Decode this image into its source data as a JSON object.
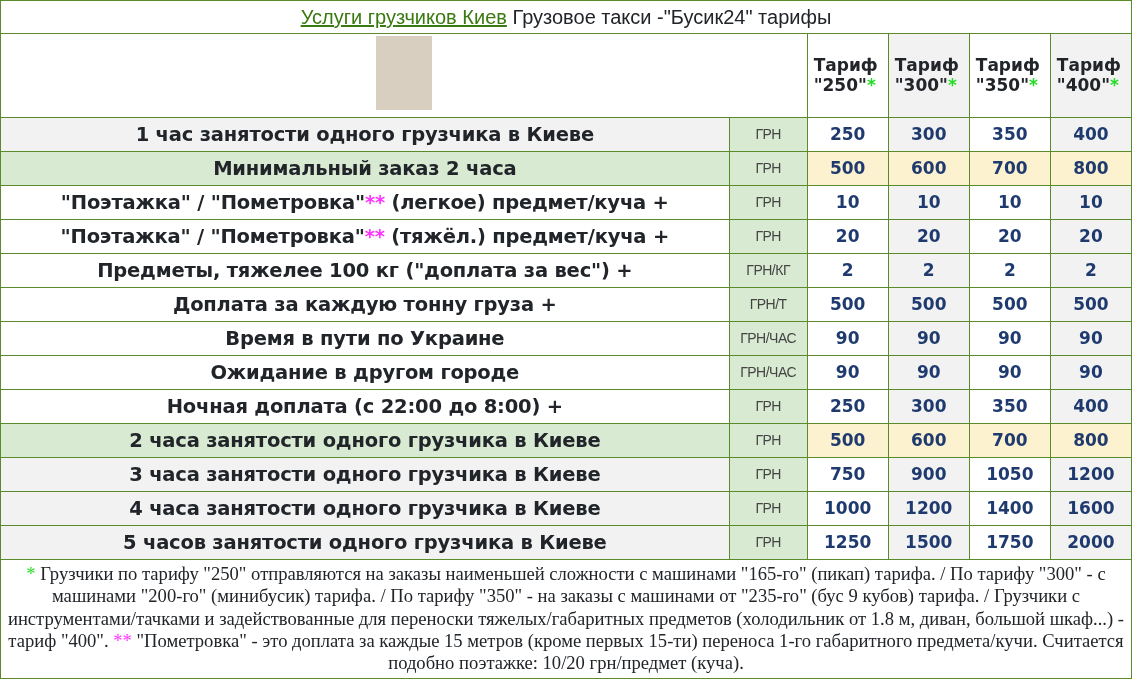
{
  "title": {
    "link": "Услуги грузчиков Киев",
    "text": "Грузовое такси -\"Бусик24\" тарифы"
  },
  "tariffs": [
    {
      "label": "Тариф \"250\"",
      "mark": "*",
      "shaded": false
    },
    {
      "label": "Тариф \"300\"",
      "mark": "*",
      "shaded": true
    },
    {
      "label": "Тариф \"350\"",
      "mark": "*",
      "shaded": false
    },
    {
      "label": "Тариф \"400\"",
      "mark": "*",
      "shaded": true
    }
  ],
  "rows": [
    {
      "kind": "grey",
      "label": [
        {
          "text": "1 час занятости одного грузчика в Киеве"
        }
      ],
      "unit": "ГРН",
      "values": [
        "250",
        "300",
        "350",
        "400"
      ]
    },
    {
      "kind": "highlight",
      "label": [
        {
          "text": "Минимальный заказ 2 часа"
        }
      ],
      "unit": "ГРН",
      "values": [
        "500",
        "600",
        "700",
        "800"
      ]
    },
    {
      "kind": "plain",
      "label": [
        {
          "text": "\"Поэтажка\" / \"Пометровка\""
        },
        {
          "text": "**",
          "color": "#ff33ff"
        },
        {
          "text": " (легкое) предмет/куча +"
        }
      ],
      "unit": "ГРН",
      "values": [
        "10",
        "10",
        "10",
        "10"
      ]
    },
    {
      "kind": "plain",
      "label": [
        {
          "text": "\"Поэтажка\" / \"Пометровка\""
        },
        {
          "text": "**",
          "color": "#ff33ff"
        },
        {
          "text": " (тяжёл.) предмет/куча +"
        }
      ],
      "unit": "ГРН",
      "values": [
        "20",
        "20",
        "20",
        "20"
      ]
    },
    {
      "kind": "plain",
      "label": [
        {
          "text": "Предметы, тяжелее 100 кг (\"доплата за вес\") +"
        }
      ],
      "unit": "ГРН/КГ",
      "values": [
        "2",
        "2",
        "2",
        "2"
      ]
    },
    {
      "kind": "plain",
      "label": [
        {
          "text": "Доплата за каждую тонну груза +"
        }
      ],
      "unit": "ГРН/Т",
      "values": [
        "500",
        "500",
        "500",
        "500"
      ]
    },
    {
      "kind": "plain",
      "label": [
        {
          "text": "Время в пути по Украине"
        }
      ],
      "unit": "ГРН/ЧАС",
      "values": [
        "90",
        "90",
        "90",
        "90"
      ]
    },
    {
      "kind": "plain",
      "label": [
        {
          "text": "Ожидание в другом городе"
        }
      ],
      "unit": "ГРН/ЧАС",
      "values": [
        "90",
        "90",
        "90",
        "90"
      ]
    },
    {
      "kind": "plain",
      "label": [
        {
          "text": "Ночная доплата (с 22:00 до 8:00) +"
        }
      ],
      "unit": "ГРН",
      "values": [
        "250",
        "300",
        "350",
        "400"
      ]
    },
    {
      "kind": "highlight",
      "label": [
        {
          "text": "2 часа занятости одного грузчика в Киеве"
        }
      ],
      "unit": "ГРН",
      "values": [
        "500",
        "600",
        "700",
        "800"
      ]
    },
    {
      "kind": "grey",
      "label": [
        {
          "text": "3 часа занятости одного грузчика в Киеве"
        }
      ],
      "unit": "ГРН",
      "values": [
        "750",
        "900",
        "1050",
        "1200"
      ]
    },
    {
      "kind": "grey",
      "label": [
        {
          "text": "4 часа занятости одного грузчика в Киеве"
        }
      ],
      "unit": "ГРН",
      "values": [
        "1000",
        "1200",
        "1400",
        "1600"
      ]
    },
    {
      "kind": "grey",
      "label": [
        {
          "text": "5 часов занятости одного грузчика в Киеве"
        }
      ],
      "unit": "ГРН",
      "values": [
        "1250",
        "1500",
        "1750",
        "2000"
      ]
    }
  ],
  "footnote": [
    {
      "text": "*",
      "color": "#22dd22"
    },
    {
      "text": " Грузчики по тарифу \"250\" отправляются на заказы наименьшей сложности с машинами \"165-го\" (пикап) тарифа. / По тарифу \"300\" - с машинами \"200-го\" (минибусик) тарифа. / По тарифу \"350\" - на заказы с машинами от \"235-го\" (бус 9 кубов) тарифа. / Грузчики с инструментами/тачками и задействованные для переноски тяжелых/габаритных предметов (холодильник от 1.8 м, диван, большой шкаф...) - тариф \"400\". "
    },
    {
      "text": "**",
      "color": "#ff33ff"
    },
    {
      "text": " \"Пометровка\" - это доплата за каждые 15 метров (кроме первых 15-ти) переноса 1-го габаритного предмета/кучи. Считается подобно поэтажке: 10/20 грн/предмет (куча)."
    }
  ]
}
